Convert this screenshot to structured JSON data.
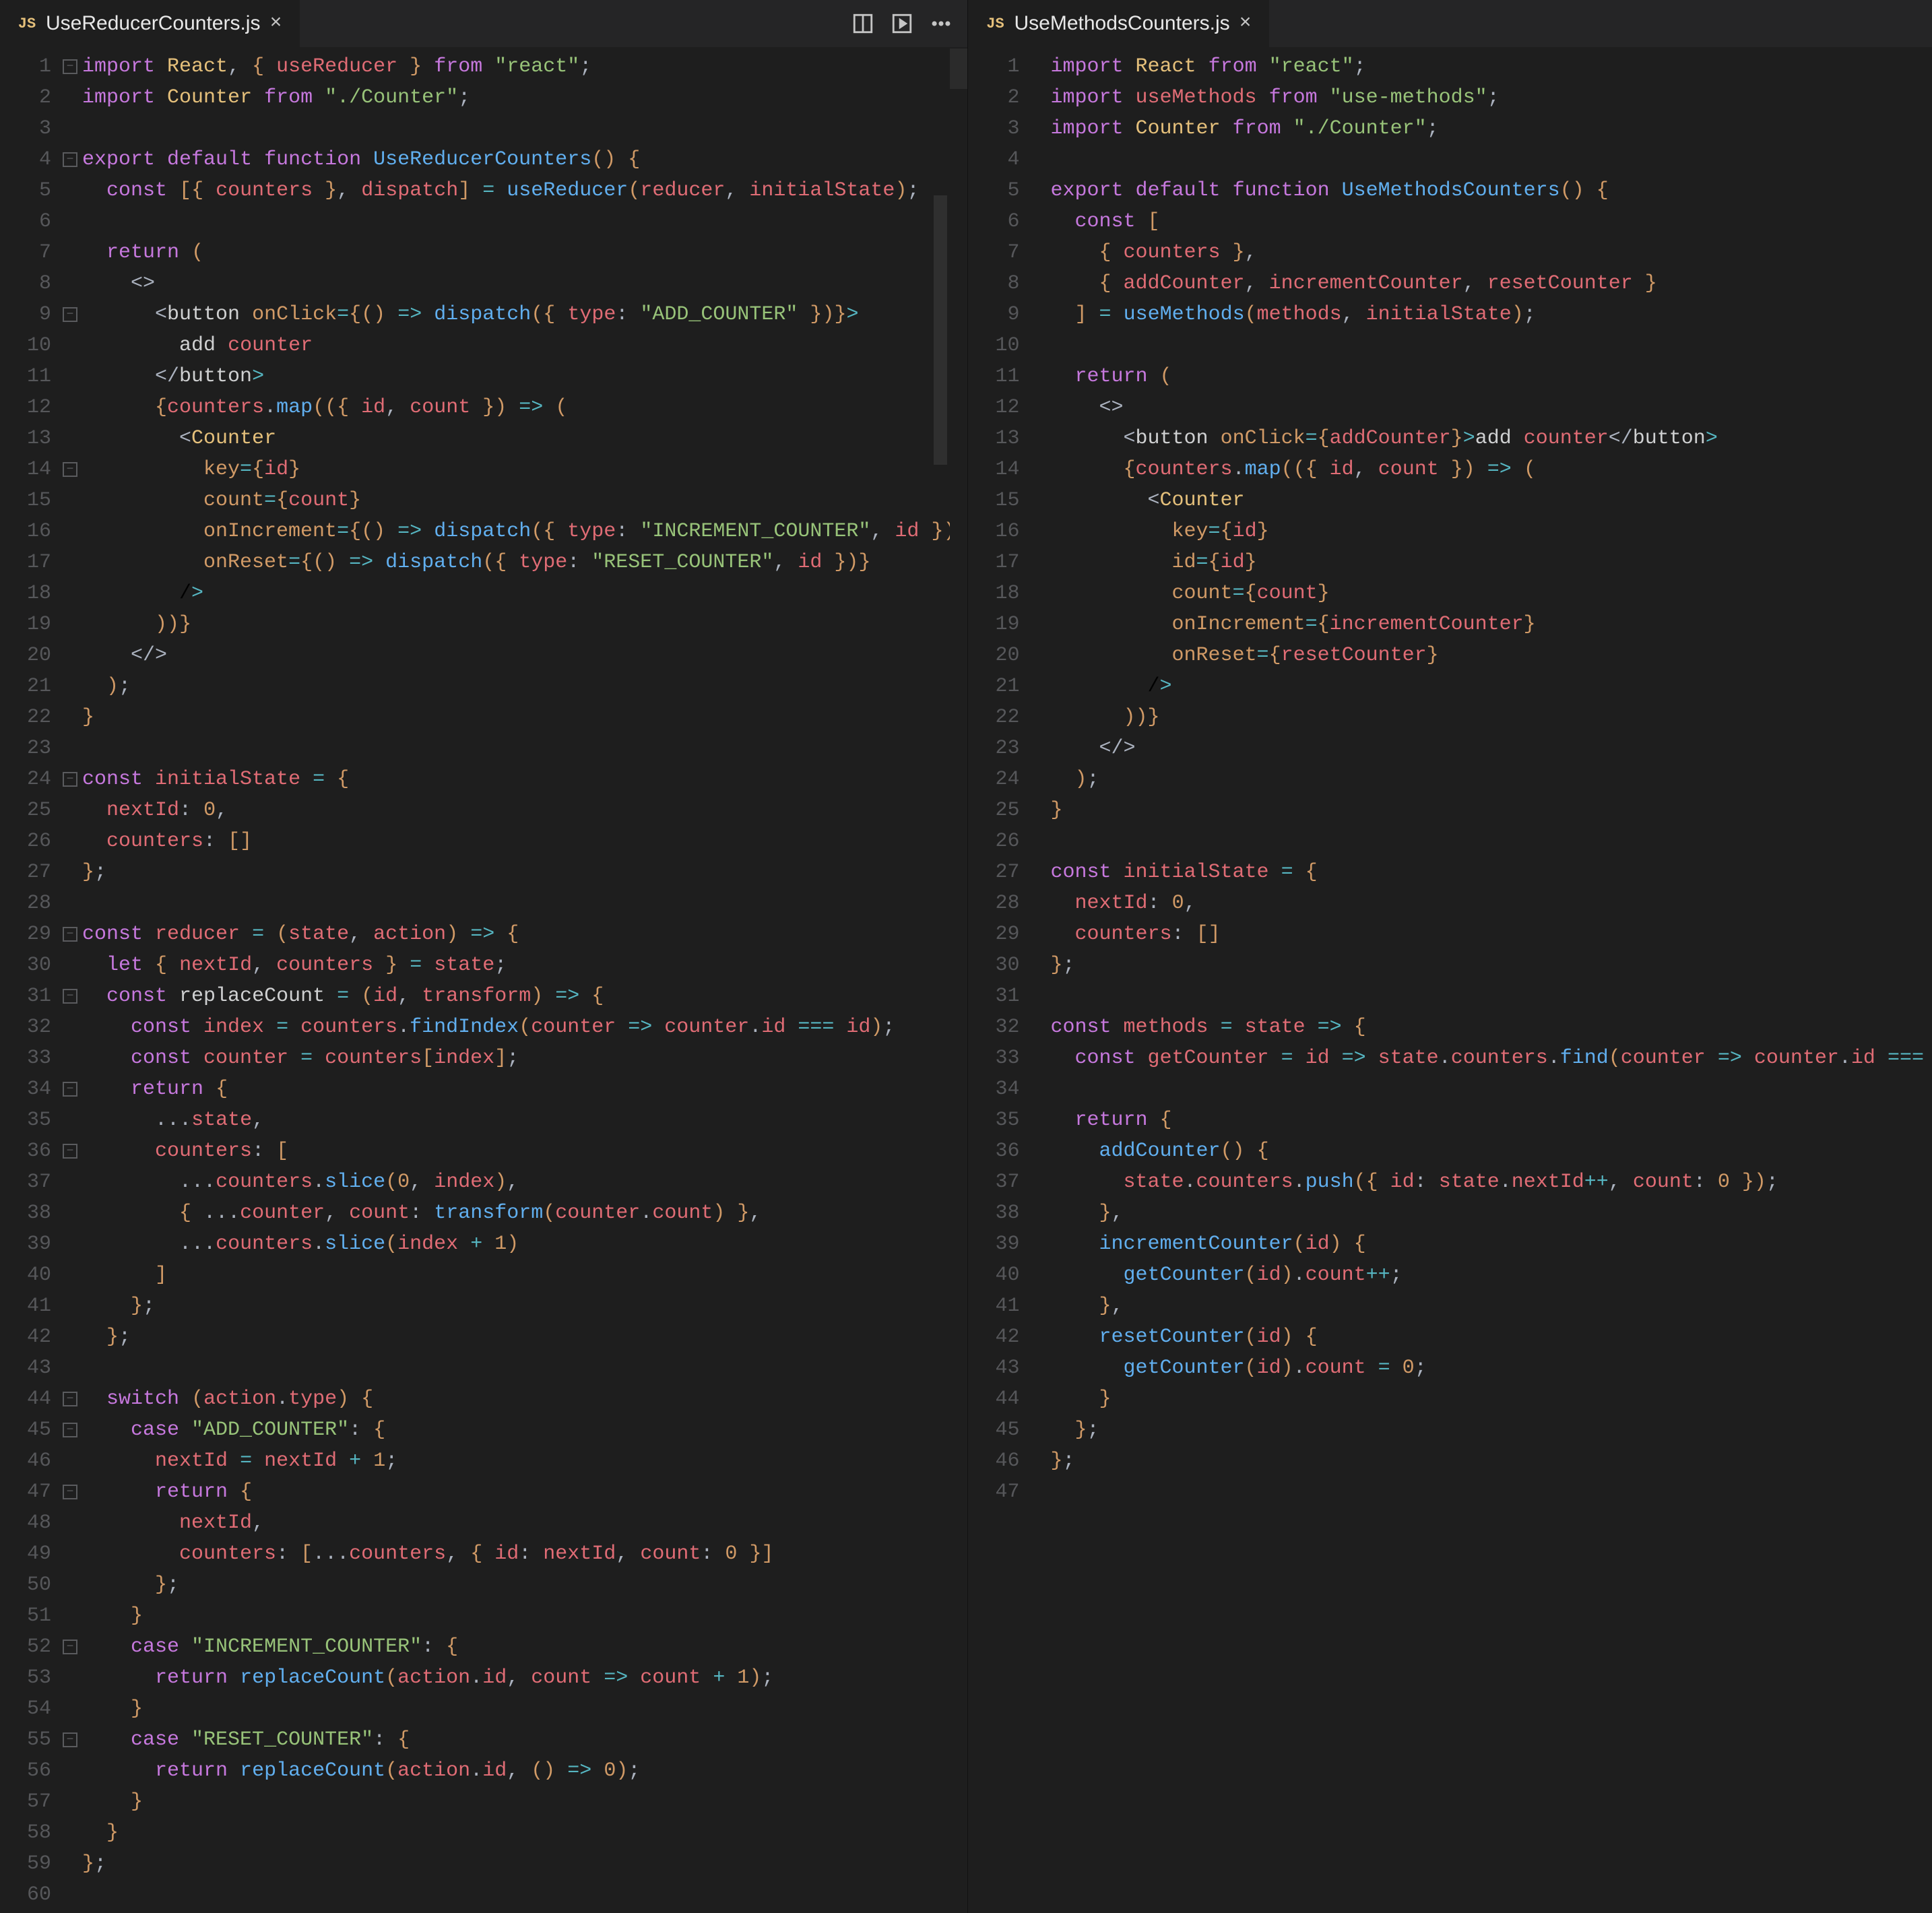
{
  "left": {
    "tab": {
      "icon": "JS",
      "name": "UseReducerCounters.js"
    },
    "actions": [
      "layout-panel-icon",
      "preview-icon",
      "more-icon"
    ],
    "folds": {
      "1": "-",
      "4": "-",
      "9": "-",
      "14": "-",
      "24": "-",
      "29": "-",
      "31": "-",
      "34": "-",
      "36": "-",
      "44": "-",
      "45": "-",
      "47": "-",
      "52": "-",
      "55": "-"
    },
    "lines": [
      "import React, { useReducer } from \"react\";",
      "import Counter from \"./Counter\";",
      "",
      "export default function UseReducerCounters() {",
      "  const [{ counters }, dispatch] = useReducer(reducer, initialState);",
      "",
      "  return (",
      "    <>",
      "      <button onClick={() => dispatch({ type: \"ADD_COUNTER\" })}>",
      "        add counter",
      "      </button>",
      "      {counters.map(({ id, count }) => (",
      "        <Counter",
      "          key={id}",
      "          count={count}",
      "          onIncrement={() => dispatch({ type: \"INCREMENT_COUNTER\", id })}",
      "          onReset={() => dispatch({ type: \"RESET_COUNTER\", id })}",
      "        />",
      "      ))}",
      "    </>",
      "  );",
      "}",
      "",
      "const initialState = {",
      "  nextId: 0,",
      "  counters: []",
      "};",
      "",
      "const reducer = (state, action) => {",
      "  let { nextId, counters } = state;",
      "  const replaceCount = (id, transform) => {",
      "    const index = counters.findIndex(counter => counter.id === id);",
      "    const counter = counters[index];",
      "    return {",
      "      ...state,",
      "      counters: [",
      "        ...counters.slice(0, index),",
      "        { ...counter, count: transform(counter.count) },",
      "        ...counters.slice(index + 1)",
      "      ]",
      "    };",
      "  };",
      "",
      "  switch (action.type) {",
      "    case \"ADD_COUNTER\": {",
      "      nextId = nextId + 1;",
      "      return {",
      "        nextId,",
      "        counters: [...counters, { id: nextId, count: 0 }]",
      "      };",
      "    }",
      "    case \"INCREMENT_COUNTER\": {",
      "      return replaceCount(action.id, count => count + 1);",
      "    }",
      "    case \"RESET_COUNTER\": {",
      "      return replaceCount(action.id, () => 0);",
      "    }",
      "  }",
      "};",
      ""
    ]
  },
  "right": {
    "tab": {
      "icon": "JS",
      "name": "UseMethodsCounters.js"
    },
    "actions": [
      "more-icon"
    ],
    "lines": [
      "import React from \"react\";",
      "import useMethods from \"use-methods\";",
      "import Counter from \"./Counter\";",
      "",
      "export default function UseMethodsCounters() {",
      "  const [",
      "    { counters },",
      "    { addCounter, incrementCounter, resetCounter }",
      "  ] = useMethods(methods, initialState);",
      "",
      "  return (",
      "    <>",
      "      <button onClick={addCounter}>add counter</button>",
      "      {counters.map(({ id, count }) => (",
      "        <Counter",
      "          key={id}",
      "          id={id}",
      "          count={count}",
      "          onIncrement={incrementCounter}",
      "          onReset={resetCounter}",
      "        />",
      "      ))}",
      "    </>",
      "  );",
      "}",
      "",
      "const initialState = {",
      "  nextId: 0,",
      "  counters: []",
      "};",
      "",
      "const methods = state => {",
      "  const getCounter = id => state.counters.find(counter => counter.id === id);",
      "",
      "  return {",
      "    addCounter() {",
      "      state.counters.push({ id: state.nextId++, count: 0 });",
      "    },",
      "    incrementCounter(id) {",
      "      getCounter(id).count++;",
      "    },",
      "    resetCounter(id) {",
      "      getCounter(id).count = 0;",
      "    }",
      "  };",
      "};",
      ""
    ]
  }
}
